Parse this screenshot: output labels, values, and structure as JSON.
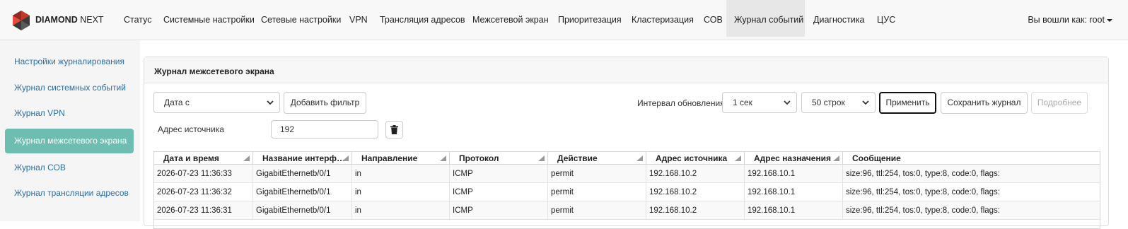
{
  "brand": {
    "bold": "DIAMOND",
    "rest": "NEXT",
    "logo_icon": "diamond-logo-icon"
  },
  "nav": {
    "items": [
      {
        "label": "Статус"
      },
      {
        "label": "Системные настройки"
      },
      {
        "label": "Сетевые настройки"
      },
      {
        "label": "VPN"
      },
      {
        "label": "Трансляция адресов"
      },
      {
        "label": "Межсетевой экран"
      },
      {
        "label": "Приоритезация"
      },
      {
        "label": "Кластеризация"
      },
      {
        "label": "СОВ"
      },
      {
        "label": "Журнал событий",
        "active": true
      },
      {
        "label": "Диагностика"
      },
      {
        "label": "ЦУС"
      }
    ],
    "user_label": "Вы вошли как: root"
  },
  "sidebar": {
    "items": [
      {
        "label": "Настройки журналирования"
      },
      {
        "label": "Журнал системных событий"
      },
      {
        "label": "Журнал VPN"
      },
      {
        "label": "Журнал межсетевого экрана",
        "active": true
      },
      {
        "label": "Журнал СОВ"
      },
      {
        "label": "Журнал трансляции адресов"
      }
    ],
    "active_color": "#6dbdb1",
    "link_color": "#2d6ea3"
  },
  "panel": {
    "title": "Журнал межсетевого экрана",
    "filter_select": "Дата с",
    "add_filter": "Добавить фильтр",
    "interval_label": "Интервал обновления",
    "interval_value": "1 сек",
    "rows_value": "50 строк",
    "apply": "Применить",
    "save_log": "Сохранить журнал",
    "details": "Подробнее",
    "filter_label": "Адрес источника",
    "filter_value": "192"
  },
  "table": {
    "columns": [
      "Дата и время",
      "Название интерф…",
      "Направление",
      "Протокол",
      "Действие",
      "Адрес источника",
      "Адрес назначения",
      "Сообщение"
    ],
    "rows": [
      [
        "2026-07-23 11:36:33",
        "GigabitEthernetb/0/1",
        "in",
        "ICMP",
        "permit",
        "192.168.10.2",
        "192.168.10.1",
        "size:96, ttl:254, tos:0, type:8, code:0, flags:"
      ],
      [
        "2026-07-23 11:36:32",
        "GigabitEthernetb/0/1",
        "in",
        "ICMP",
        "permit",
        "192.168.10.2",
        "192.168.10.1",
        "size:96, ttl:254, tos:0, type:8, code:0, flags:"
      ],
      [
        "2026-07-23 11:36:31",
        "GigabitEthernetb/0/1",
        "in",
        "ICMP",
        "permit",
        "192.168.10.2",
        "192.168.10.1",
        "size:96, ttl:254, tos:0, type:8, code:0, flags:"
      ]
    ]
  }
}
